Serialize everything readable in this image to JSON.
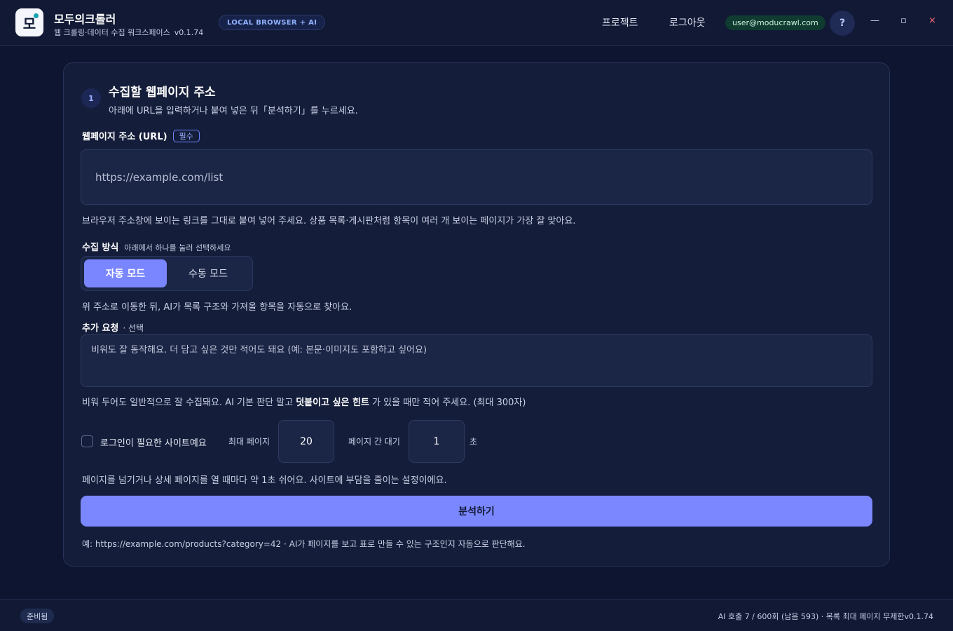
{
  "header": {
    "logo_text": "모",
    "app_title": "모두의크롤러",
    "app_subtitle": "웹 크롤링·데이터 수집 워크스페이스",
    "version": "v0.1.74",
    "mode_badge": "LOCAL BROWSER + AI",
    "nav": {
      "projects": "프로젝트",
      "logout": "로그아웃"
    },
    "user_email": "user@moducrawl.com",
    "help_label": "?",
    "window": {
      "minimize": "—",
      "maximize": "▫",
      "close": "×"
    }
  },
  "step": {
    "number": "1",
    "title": "수집할 웹페이지 주소",
    "description": "아래에 URL을 입력하거나 붙여 넣은 뒤「분석하기」를 누르세요."
  },
  "url_field": {
    "label": "웹페이지 주소 (URL)",
    "required_badge": "필수",
    "placeholder": "https://example.com/list",
    "value": "",
    "help": "브라우저 주소창에 보이는 링크를 그대로 붙여 넣어 주세요. 상품 목록·게시판처럼 항목이 여러 개 보이는 페이지가 가장 잘 맞아요."
  },
  "method": {
    "label": "수집 방식",
    "sublabel": "아래에서 하나를 눌러 선택하세요",
    "options": [
      "자동 모드",
      "수동 모드"
    ],
    "selected": "자동 모드",
    "help": "위 주소로 이동한 뒤, AI가 목록 구조와 가져올 항목을 자동으로 찾아요."
  },
  "extra_request": {
    "label": "추가 요청",
    "optional": "· 선택",
    "placeholder": "비워도 잘 동작해요. 더 담고 싶은 것만 적어도 돼요 (예: 본문·이미지도 포함하고 싶어요)",
    "hint_before": "비워 두어도 일반적으로 잘 수집돼요. AI 기본 판단 말고 ",
    "hint_strong": "덧붙이고 싶은 힌트",
    "hint_after": " 가 있을 때만 적어 주세요. (최대 300자)"
  },
  "options": {
    "login_required_label": "로그인이 필요한 사이트예요",
    "login_required": false,
    "max_pages_label": "최대 페이지",
    "max_pages": "20",
    "delay_label": "페이지 간 대기",
    "delay": "1",
    "delay_unit": "초",
    "delay_help": "페이지를 넘기거나 상세 페이지를 열 때마다 약 1초 쉬어요. 사이트에 부담을 줄이는 설정이에요."
  },
  "analyze_button": "분석하기",
  "example": "예: https://example.com/products?category=42 · AI가 페이지를 보고 표로 만들 수 있는 구조인지 자동으로 판단해요.",
  "footer": {
    "status": "준비됨",
    "info": "AI 호출 7 / 600회 (남음 593) · 목록 최대 페이지 무제한v0.1.74"
  },
  "colors": {
    "background": "#0e1530",
    "card": "#141d3a",
    "accent": "#7a86ff",
    "email_pill": "#0f3b30",
    "close": "#ff6b75"
  }
}
